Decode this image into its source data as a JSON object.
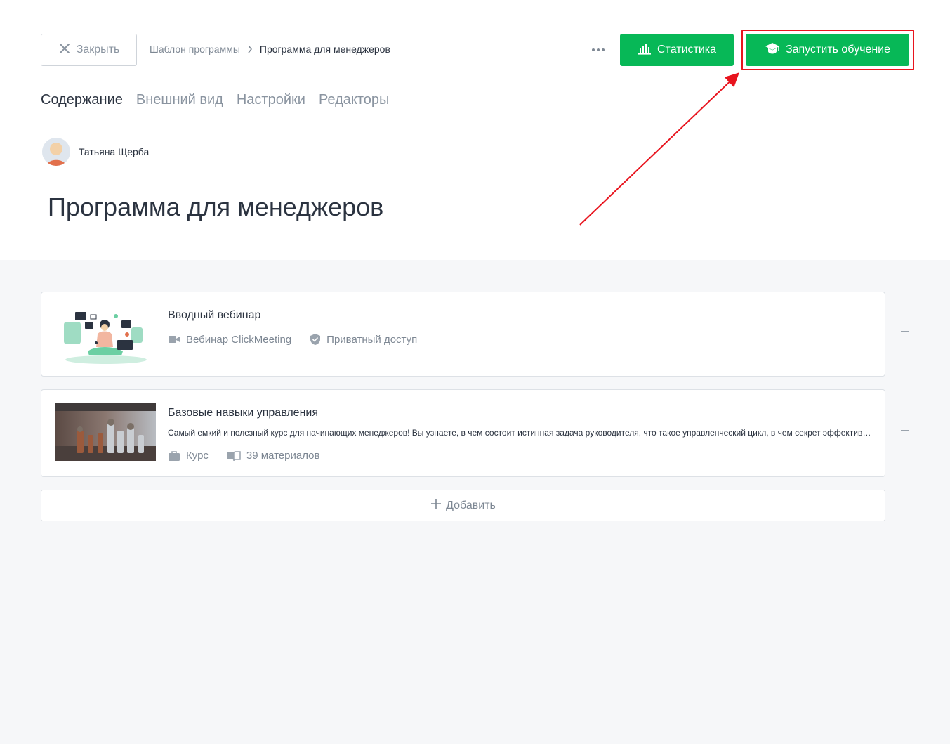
{
  "header": {
    "close_label": "Закрыть",
    "breadcrumb": {
      "parent": "Шаблон программы",
      "current": "Программа для менеджеров"
    },
    "statistics_label": "Статистика",
    "launch_label": "Запустить обучение"
  },
  "tabs": [
    {
      "label": "Содержание",
      "active": true
    },
    {
      "label": "Внешний вид",
      "active": false
    },
    {
      "label": "Настройки",
      "active": false
    },
    {
      "label": "Редакторы",
      "active": false
    }
  ],
  "author": {
    "name": "Татьяна Щерба"
  },
  "program": {
    "title": "Программа для менеджеров"
  },
  "items": [
    {
      "title": "Вводный вебинар",
      "meta": [
        {
          "icon": "video-camera-icon",
          "text": "Вебинар ClickMeeting"
        },
        {
          "icon": "shield-check-icon",
          "text": "Приватный доступ"
        }
      ]
    },
    {
      "title": "Базовые навыки управления",
      "description": "Самый емкий и полезный курс для начинающих менеджеров! Вы узнаете, в чем состоит истинная задача руководителя, что такое управленческий цикл, в чем секрет эффективного управления",
      "meta": [
        {
          "icon": "briefcase-icon",
          "text": "Курс"
        },
        {
          "icon": "book-icon",
          "text": "39 материалов"
        }
      ]
    }
  ],
  "add_label": "Добавить",
  "colors": {
    "accent_green": "#07b857",
    "annotation_red": "#e8141e",
    "muted_text": "#7d8793",
    "dark_text": "#2b3340",
    "content_background": "#f6f7f9"
  }
}
